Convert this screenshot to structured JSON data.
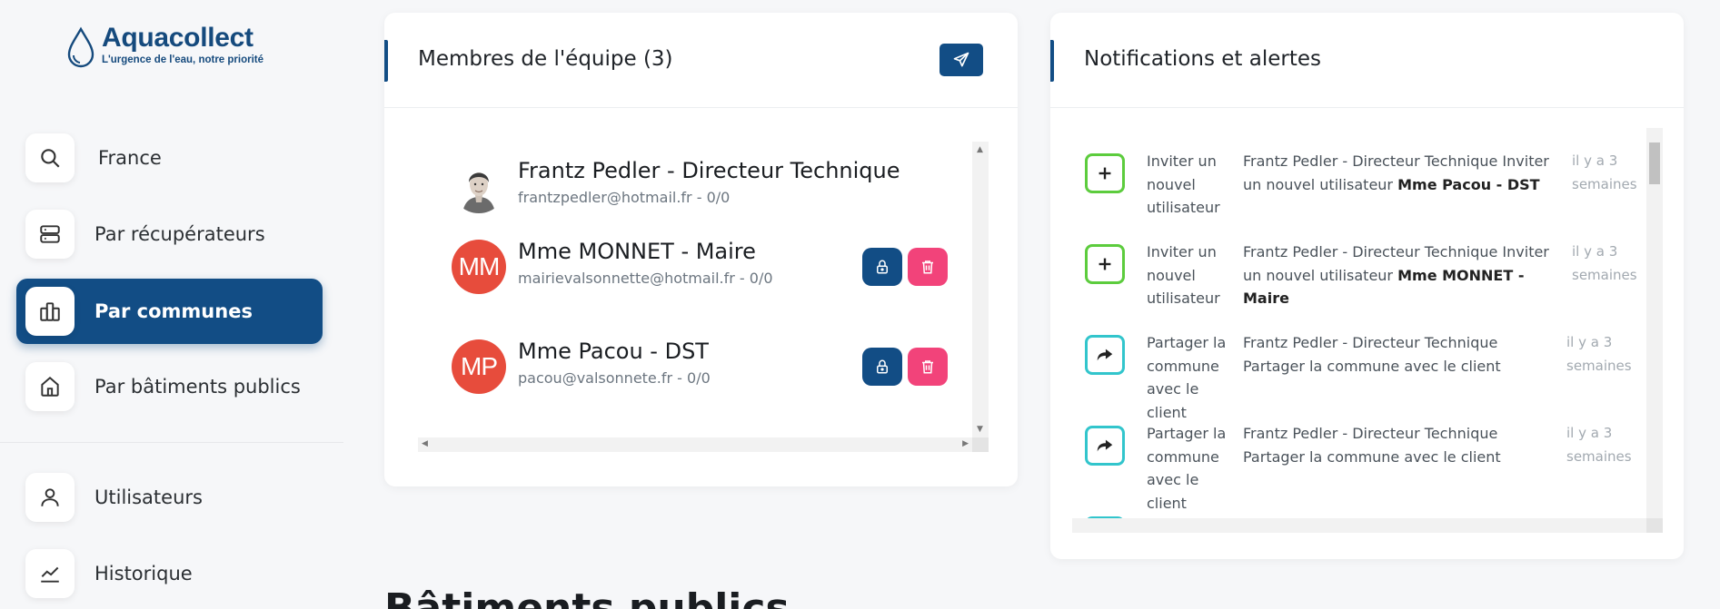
{
  "brand": {
    "name": "Aquacollect",
    "tagline": "L'urgence de l'eau, notre priorité",
    "color": "#154a7d"
  },
  "sidebar": {
    "items": [
      {
        "label": "France",
        "icon": "search-icon",
        "active": false
      },
      {
        "label": "Par récupérateurs",
        "icon": "server-icon",
        "active": false
      },
      {
        "label": "Par communes",
        "icon": "buildings-icon",
        "active": true
      },
      {
        "label": "Par bâtiments publics",
        "icon": "home-icon",
        "active": false
      },
      {
        "label": "Utilisateurs",
        "icon": "user-icon",
        "active": false
      },
      {
        "label": "Historique",
        "icon": "chart-line-icon",
        "active": false
      }
    ]
  },
  "team": {
    "title": "Membres de l'équipe (3)",
    "send_icon": "send-icon",
    "members": [
      {
        "name": "Frantz Pedler - Directeur Technique",
        "email": "frantzpedler@hotmail.fr",
        "score": "0/0",
        "avatar_type": "photo",
        "initials": ""
      },
      {
        "name": "Mme MONNET - Maire",
        "email": "mairievalsonnette@hotmail.fr",
        "score": "0/0",
        "avatar_type": "initials",
        "initials": "MM"
      },
      {
        "name": "Mme Pacou - DST",
        "email": "pacou@valsonnete.fr",
        "score": "0/0",
        "avatar_type": "initials",
        "initials": "MP"
      }
    ]
  },
  "notifications": {
    "title": "Notifications et alertes",
    "items": [
      {
        "icon": "plus-icon",
        "color": "green",
        "type": "Inviter un nouvel utilisateur",
        "message": "Frantz Pedler - Directeur Technique Inviter un nouvel utilisateur",
        "target": "Mme Pacou - DST",
        "time": "il y a 3 semaines"
      },
      {
        "icon": "plus-icon",
        "color": "green",
        "type": "Inviter un nouvel utilisateur",
        "message": "Frantz Pedler - Directeur Technique Inviter un nouvel utilisateur",
        "target": "Mme MONNET - Maire",
        "time": "il y a 3 semaines"
      },
      {
        "icon": "share-icon",
        "color": "teal",
        "type": "Partager la commune avec le client",
        "message": "Frantz Pedler - Directeur Technique Partager la commune avec le client",
        "target": "",
        "time": "il y a 3 semaines"
      },
      {
        "icon": "share-icon",
        "color": "teal",
        "type": "Partager la commune avec le client",
        "message": "Frantz Pedler - Directeur Technique Partager la commune avec le client",
        "target": "",
        "time": "il y a 3 semaines"
      }
    ]
  },
  "section": {
    "title": "Bâtiments publics"
  },
  "colors": {
    "primary": "#124d85",
    "danger": "#f2437a",
    "avatar": "#e74c3c",
    "green": "#5ccc3d",
    "teal": "#32c5cc"
  }
}
